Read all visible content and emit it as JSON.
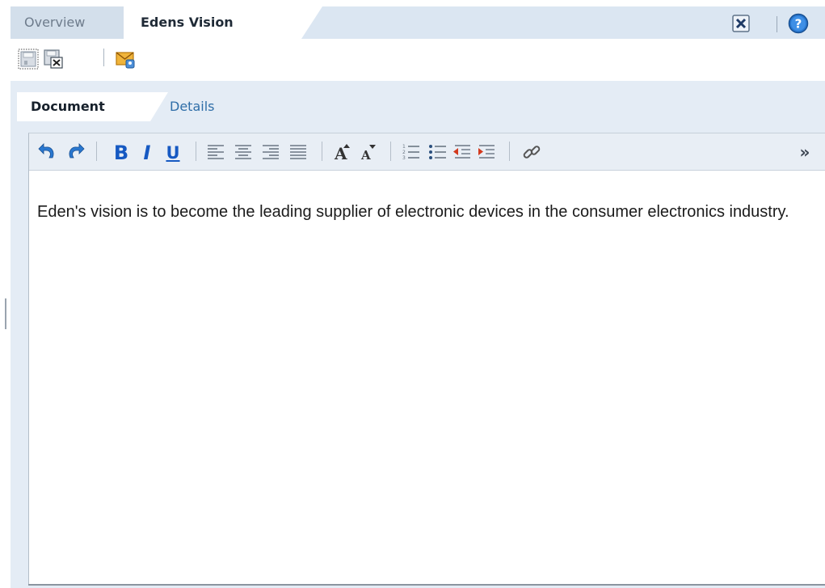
{
  "top_tabs": [
    {
      "label": "Overview",
      "active": false
    },
    {
      "label": "Edens Vision",
      "active": true
    }
  ],
  "header_icons": [
    "close-box-icon",
    "help-icon"
  ],
  "action_toolbar": [
    "save-icon",
    "save-and-close-icon",
    "email-icon"
  ],
  "sub_tabs": [
    {
      "label": "Document",
      "active": true
    },
    {
      "label": "Details",
      "active": false
    }
  ],
  "format_toolbar": {
    "groups": [
      [
        "undo-icon",
        "redo-icon"
      ],
      [
        "bold-icon",
        "italic-icon",
        "underline-icon"
      ],
      [
        "align-left-icon",
        "align-center-icon",
        "align-right-icon",
        "justify-icon"
      ],
      [
        "increase-font-icon",
        "decrease-font-icon"
      ],
      [
        "numbered-list-icon",
        "bullet-list-icon",
        "outdent-icon",
        "indent-icon"
      ],
      [
        "link-icon"
      ]
    ],
    "bold_label": "B",
    "italic_label": "I",
    "underline_label": "U",
    "more_label": "»"
  },
  "document": {
    "text": "Eden's vision is to become the leading supplier of electronic devices in the consumer electronics industry."
  },
  "colors": {
    "tab_bar": "#dbe6f2",
    "panel": "#e4ecf5",
    "format_bar": "#e8eef5",
    "accent_blue": "#1659c2"
  }
}
